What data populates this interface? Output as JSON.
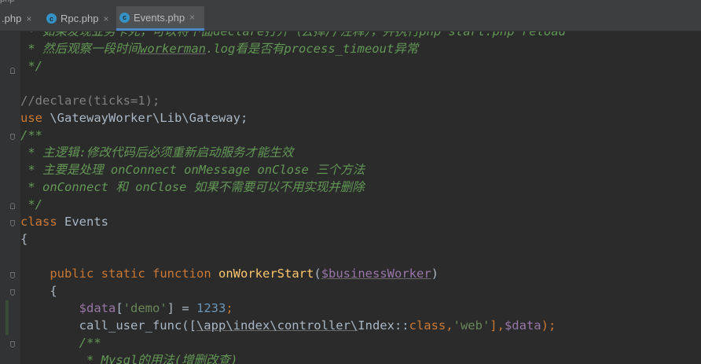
{
  "window": {
    "top_label": "php"
  },
  "tabs": [
    {
      "label": ".php",
      "active": false
    },
    {
      "label": "Rpc.php",
      "icon": "c",
      "active": false
    },
    {
      "label": "Events.php",
      "icon": "c",
      "active": true
    }
  ],
  "tab_close_glyph": "×",
  "code": {
    "l0_text": " * 如果发现业务卡死，可以将下面declare打开（去掉//注释），并执行php start.php reload",
    "l1_a": " * 然后观察一段时间",
    "l1_b": "workerman",
    "l1_c": ".log看是否有process_timeout异常",
    "l2_text": " */",
    "l4_text": "//declare(ticks=1);",
    "l5_kw": "use",
    "l5_rest": " \\GatewayWorker\\Lib\\Gateway;",
    "l6_text": "/**",
    "l7_a": " * 主逻辑",
    "l7_b": ":",
    "l7_c": "修改代码后必须重新启动服务才能生效",
    "l8_text": " * 主要是处理 onConnect onMessage onClose 三个方法",
    "l9_text": " * onConnect 和 onClose 如果不需要可以不用实现并删除",
    "l10_text": " */",
    "l11_kw": "class",
    "l11_name": " Events",
    "l12_text": "{",
    "l14_indent": "    ",
    "l14_public": "public",
    "l14_static": "static",
    "l14_function": "function",
    "l14_fname": "onWorkerStart",
    "l14_open": "(",
    "l14_param": "$businessWorker",
    "l14_close": ")",
    "l15_text": "    {",
    "l16_indent": "        ",
    "l16_var": "$data",
    "l16_key_open": "[",
    "l16_key": "'demo'",
    "l16_key_close": "]",
    "l16_eq": " = ",
    "l16_num": "1233",
    "l16_end": ";",
    "l17_indent": "        ",
    "l17_fn": "call_user_func([",
    "l17_path": "\\app\\index\\controller\\",
    "l17_cls": "Index::",
    "l17_kwclass": "class",
    "l17_comma": ",",
    "l17_str": "'web'",
    "l17_mid": "],",
    "l17_var": "$data",
    "l17_end": ");",
    "l18_text": "        /**",
    "l19_text": "         * Mysql的用法(增删改查)"
  }
}
